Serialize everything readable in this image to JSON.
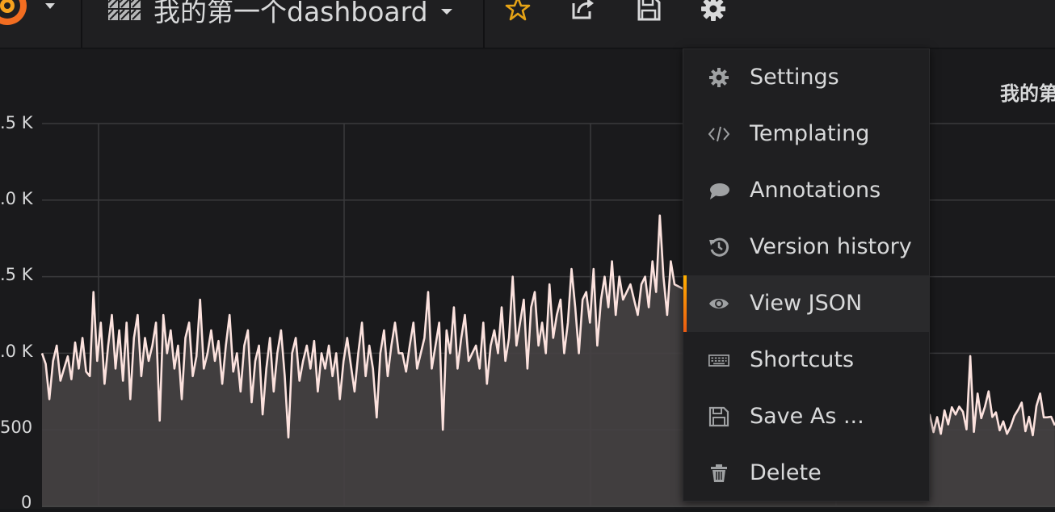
{
  "navbar": {
    "dashboard_title": "我的第一个dashboard",
    "icons": [
      "grafana-logo-icon",
      "dashboard-grid-icon",
      "star-icon",
      "share-icon",
      "save-icon",
      "gear-icon"
    ]
  },
  "panel": {
    "title": "我的第"
  },
  "menu": {
    "items": [
      {
        "label": "Settings",
        "icon": "gear-icon"
      },
      {
        "label": "Templating",
        "icon": "code-icon"
      },
      {
        "label": "Annotations",
        "icon": "comment-icon"
      },
      {
        "label": "Version history",
        "icon": "history-icon"
      },
      {
        "label": "View JSON",
        "icon": "eye-icon",
        "active": true
      },
      {
        "label": "Shortcuts",
        "icon": "keyboard-icon"
      },
      {
        "label": "Save As ...",
        "icon": "save-icon"
      },
      {
        "label": "Delete",
        "icon": "trash-icon"
      }
    ]
  },
  "colors": {
    "accent": "#eb7b18",
    "line": "#fce2de",
    "fill": "#464244",
    "star": "#e6a316"
  },
  "chart_data": {
    "type": "area",
    "y_tick_labels": [
      ".5 K",
      ".0 K",
      ".5 K",
      ".0 K",
      "500",
      "0"
    ],
    "y_tick_values": [
      2500,
      2000,
      1500,
      1000,
      500,
      0
    ],
    "ylim": [
      0,
      2500
    ],
    "grid": true,
    "x_count": 630,
    "series": [
      {
        "values": [
          1000,
          930,
          700,
          950,
          1050,
          820,
          900,
          980,
          830,
          1070,
          900,
          1100,
          880,
          850,
          1400,
          950,
          1200,
          800,
          1050,
          1250,
          900,
          1150,
          820,
          1200,
          700,
          1100,
          1250,
          850,
          1100,
          950,
          1050,
          1200,
          560,
          1250,
          1000,
          1150,
          900,
          1050,
          700,
          1100,
          1200,
          850,
          980,
          1350,
          900,
          1000,
          1150,
          950,
          1080,
          800,
          1050,
          1250,
          880,
          1000,
          750,
          1050,
          1150,
          680,
          950,
          1050,
          600,
          900,
          1100,
          750,
          1000,
          1150,
          850,
          450,
          1000,
          1100,
          820,
          950,
          1050,
          900,
          1080,
          750,
          1000,
          900,
          1050,
          850,
          1000,
          700,
          950,
          1100,
          920,
          750,
          1000,
          1200,
          850,
          1050,
          900,
          580,
          1000,
          1150,
          850,
          1050,
          1200,
          1000,
          1000,
          880,
          1050,
          1200,
          900,
          1000,
          1100,
          1400,
          900,
          1050,
          1200,
          500,
          1150,
          1000,
          1300,
          900,
          1100,
          1250,
          950,
          1000,
          1050,
          900,
          1200,
          800,
          1050,
          1150,
          1000,
          1300,
          950,
          1100,
          1500,
          1050,
          1200,
          1350,
          900,
          1300,
          1400,
          1050,
          1200,
          1000,
          1450,
          1100,
          1250,
          1350,
          1000,
          1200,
          1550,
          1300,
          1000,
          1350,
          1400,
          1200,
          1550,
          1050,
          1350,
          1500,
          1300,
          1600,
          1250,
          1500,
          1350,
          1400,
          1450,
          1350,
          1250,
          1450,
          1500,
          1300,
          1600,
          1400,
          1900,
          1500,
          1250,
          1600,
          1450
        ],
        "full_length": 630,
        "note_tail": "values continue at lower level after menu"
      }
    ]
  }
}
